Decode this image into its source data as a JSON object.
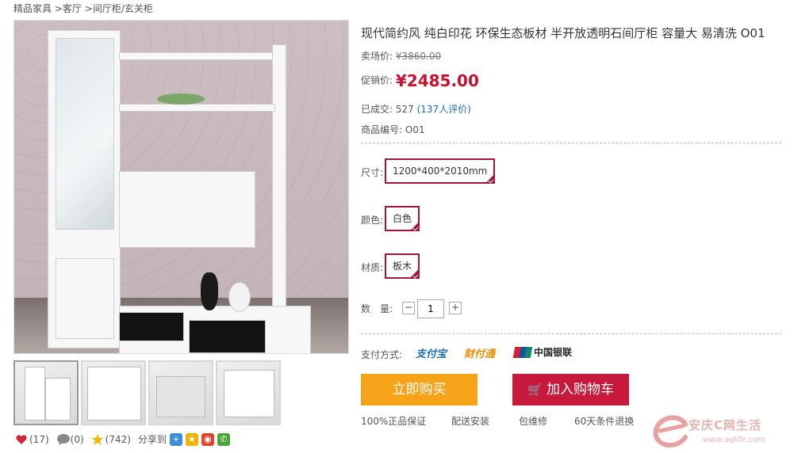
{
  "breadcrumb": {
    "c1": "精品家具",
    "c2": "客厅",
    "c3": "间厅柜/玄关柜",
    "sep": ">"
  },
  "product": {
    "title": "现代简约风 纯白印花 环保生态板材 半开放透明石间厅柜 容量大 易清洗 O01",
    "market_label": "卖场价:",
    "market_price": "¥3860.00",
    "promo_label": "促销价:",
    "promo_price": "¥2485.00",
    "sold_label": "已成交:",
    "sold_count": "527",
    "reviews": "(137人评价)",
    "code_label": "商品编号:",
    "code": "O01"
  },
  "options": {
    "size_label": "尺寸:",
    "size_value": "1200*400*2010mm",
    "color_label": "颜色:",
    "color_value": "白色",
    "material_label": "材质:",
    "material_value": "板木"
  },
  "quantity": {
    "label": "数　量:",
    "minus": "−",
    "plus": "+",
    "value": "1"
  },
  "payment": {
    "label": "支付方式:",
    "alipay": "支付宝",
    "tenpay": "财付通",
    "unionpay": "中国银联"
  },
  "buttons": {
    "buy_now": "立即购买",
    "add_cart": "加入购物车",
    "cart_icon": "🛒"
  },
  "guarantees": [
    "100%正品保证",
    "配送安装",
    "包维修",
    "60天条件退换"
  ],
  "social": {
    "likes": "(17)",
    "comments": "(0)",
    "stars": "(742)",
    "share_label": "分享到"
  },
  "watermark": {
    "text": "安庆C网生活",
    "url": "www.aqlife.com"
  },
  "colors": {
    "accent": "#c8102e",
    "buy": "#f7a31a",
    "cart": "#c6193b",
    "option_border": "#a0173b",
    "link": "#1a6fb3"
  }
}
